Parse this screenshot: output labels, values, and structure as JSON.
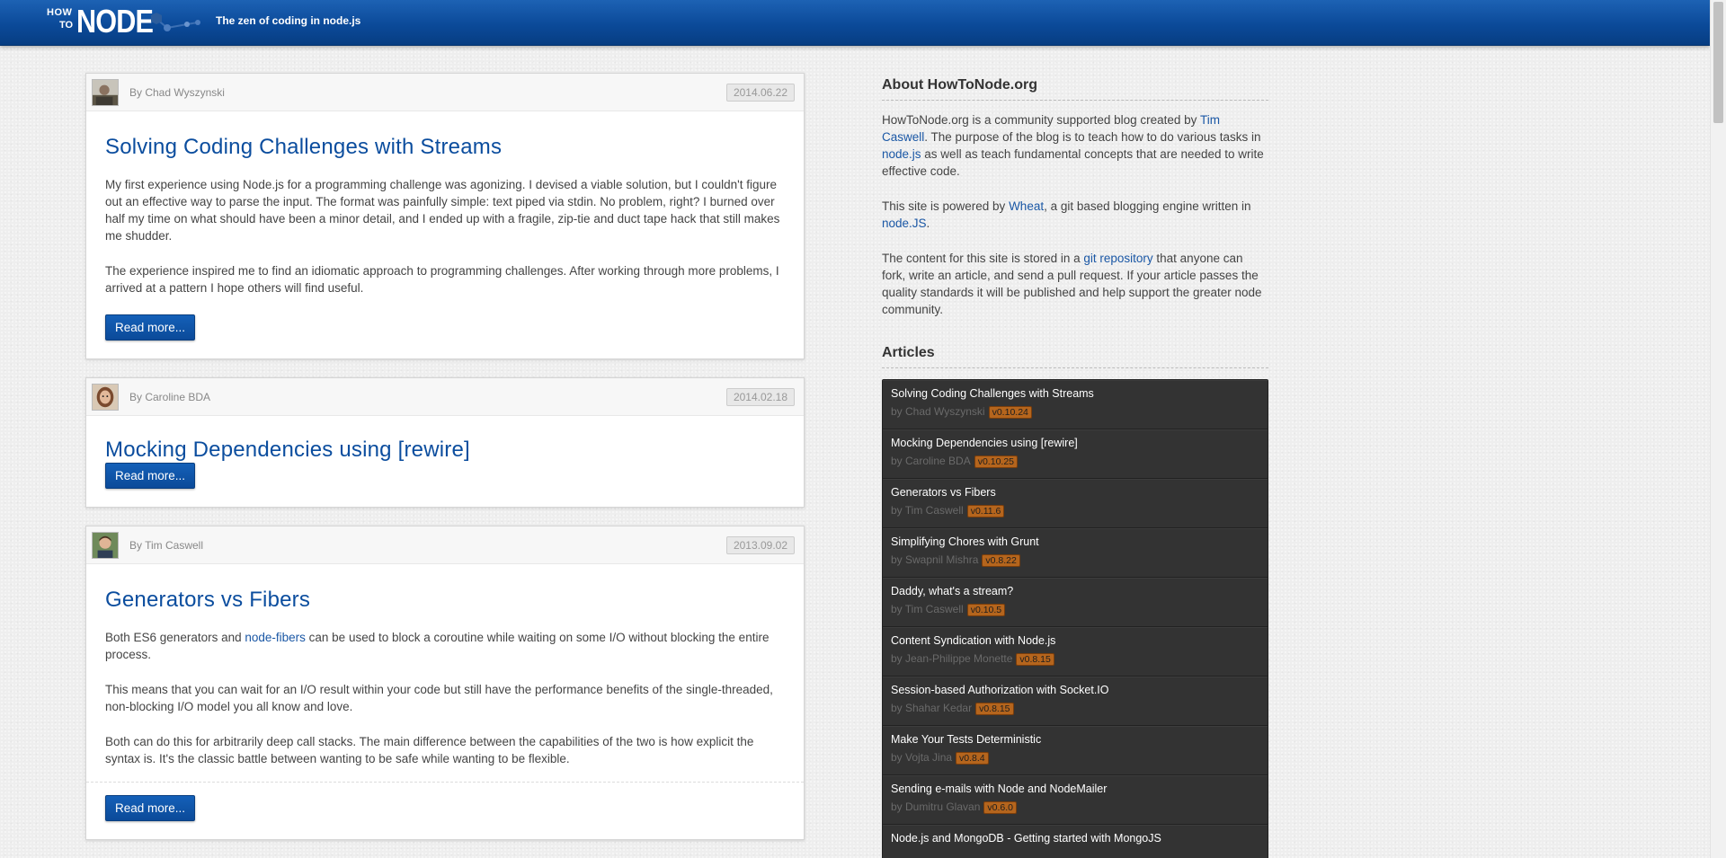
{
  "header": {
    "logo_how": "HOW",
    "logo_to": "TO",
    "logo_node": "NODE",
    "tagline": "The zen of coding in node.js"
  },
  "posts": [
    {
      "author": "By Chad Wyszynski",
      "date": "2014.06.22",
      "title": "Solving Coding Challenges with Streams",
      "p1": "My first experience using Node.js for a programming challenge was agonizing. I devised a viable solution, but I couldn't figure out an effective way to parse the input. The format was painfully simple: text piped via stdin. No problem, right? I burned over half my time on what should have been a minor detail, and I ended up with a fragile, zip-tie and duct tape hack that still makes me shudder.",
      "p2": "The experience inspired me to find an idiomatic approach to programming challenges. After working through more problems, I arrived at a pattern I hope others will find useful.",
      "read_more": "Read more..."
    },
    {
      "author": "By Caroline BDA",
      "date": "2014.02.18",
      "title": "Mocking Dependencies using [rewire]",
      "read_more": "Read more..."
    },
    {
      "author": "By Tim Caswell",
      "date": "2013.09.02",
      "title": "Generators vs Fibers",
      "p1_before": "Both ES6 generators and ",
      "p1_link": "node-fibers",
      "p1_after": " can be used to block a coroutine while waiting on some I/O without blocking the entire process.",
      "p2": "This means that you can wait for an I/O result within your code but still have the performance benefits of the single-threaded, non-blocking I/O model you all know and love.",
      "p3": "Both can do this for arbitrarily deep call stacks. The main difference between the capabilities of the two is how explicit the syntax is. It's the classic battle between wanting to be safe while wanting to be flexible.",
      "read_more": "Read more..."
    }
  ],
  "sidebar": {
    "about_heading": "About HowToNode.org",
    "about": {
      "t1": "HowToNode.org is a community supported blog created by ",
      "l1": "Tim Caswell",
      "t2": ". The purpose of the blog is to teach how to do various tasks in ",
      "l2": "node.js",
      "t3": " as well as teach fundamental concepts that are needed to write effective code."
    },
    "powered": {
      "t1": "This site is powered by ",
      "l1": "Wheat",
      "t2": ", a git based blogging engine written in ",
      "l2": "node.JS",
      "t3": "."
    },
    "content": {
      "t1": "The content for this site is stored in a ",
      "l1": "git repository",
      "t2": " that anyone can fork, write an article, and send a pull request. If your article passes the quality standards it will be published and help support the greater node community."
    },
    "articles_heading": "Articles",
    "articles": [
      {
        "title": "Solving Coding Challenges with Streams",
        "by": "by Chad Wyszynski",
        "version": "v0.10.24"
      },
      {
        "title": "Mocking Dependencies using [rewire]",
        "by": "by Caroline BDA",
        "version": "v0.10.25"
      },
      {
        "title": "Generators vs Fibers",
        "by": "by Tim Caswell",
        "version": "v0.11.6"
      },
      {
        "title": "Simplifying Chores with Grunt",
        "by": "by Swapnil Mishra",
        "version": "v0.8.22"
      },
      {
        "title": "Daddy, what's a stream?",
        "by": "by Tim Caswell",
        "version": "v0.10.5"
      },
      {
        "title": "Content Syndication with Node.js",
        "by": "by Jean-Philippe Monette",
        "version": "v0.8.15"
      },
      {
        "title": "Session-based Authorization with Socket.IO",
        "by": "by Shahar Kedar",
        "version": "v0.8.15"
      },
      {
        "title": "Make Your Tests Deterministic",
        "by": "by Vojta Jina",
        "version": "v0.8.4"
      },
      {
        "title": "Sending e-mails with Node and NodeMailer",
        "by": "by Dumitru Glavan",
        "version": "v0.6.0"
      },
      {
        "title": "Node.js and MongoDB - Getting started with MongoJS",
        "by": "",
        "version": ""
      }
    ]
  },
  "colors": {
    "header_blue": "#0b4a99",
    "link_blue": "#1a57a5",
    "title_blue": "#0b4d9e",
    "version_badge": "#b5651d",
    "articles_bg": "#333333"
  },
  "icons": [
    "molecule-logo-icon",
    "avatar-chad",
    "avatar-caroline",
    "avatar-tim"
  ]
}
